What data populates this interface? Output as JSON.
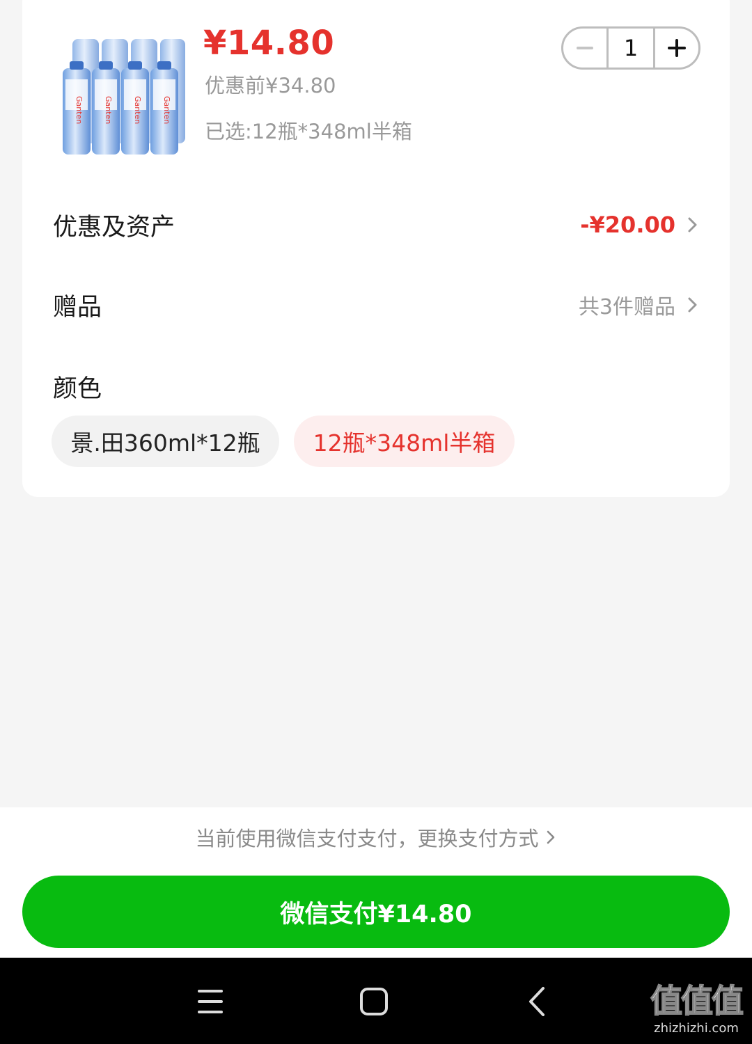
{
  "product": {
    "price_now": "¥14.80",
    "price_original": "优惠前¥34.80",
    "selected_spec": "已选:12瓶*348ml半箱",
    "quantity": "1",
    "thumb_label": "Ganten"
  },
  "rows": {
    "discount": {
      "label": "优惠及资产",
      "value": "-¥20.00"
    },
    "gifts": {
      "label": "赠品",
      "value": "共3件赠品"
    }
  },
  "color": {
    "title": "颜色",
    "options": [
      {
        "label": "景.田360ml*12瓶",
        "selected": false
      },
      {
        "label": "12瓶*348ml半箱",
        "selected": true
      }
    ]
  },
  "payment": {
    "method_text": "当前使用微信支付支付，更换支付方式",
    "button_label": "微信支付¥14.80"
  },
  "watermark": {
    "logo_text": "值值值",
    "site": "zhizhizhi.com"
  },
  "colors": {
    "price_red": "#e5322d",
    "pay_green": "#08bb10",
    "selected_chip_bg": "#fdeeee"
  }
}
